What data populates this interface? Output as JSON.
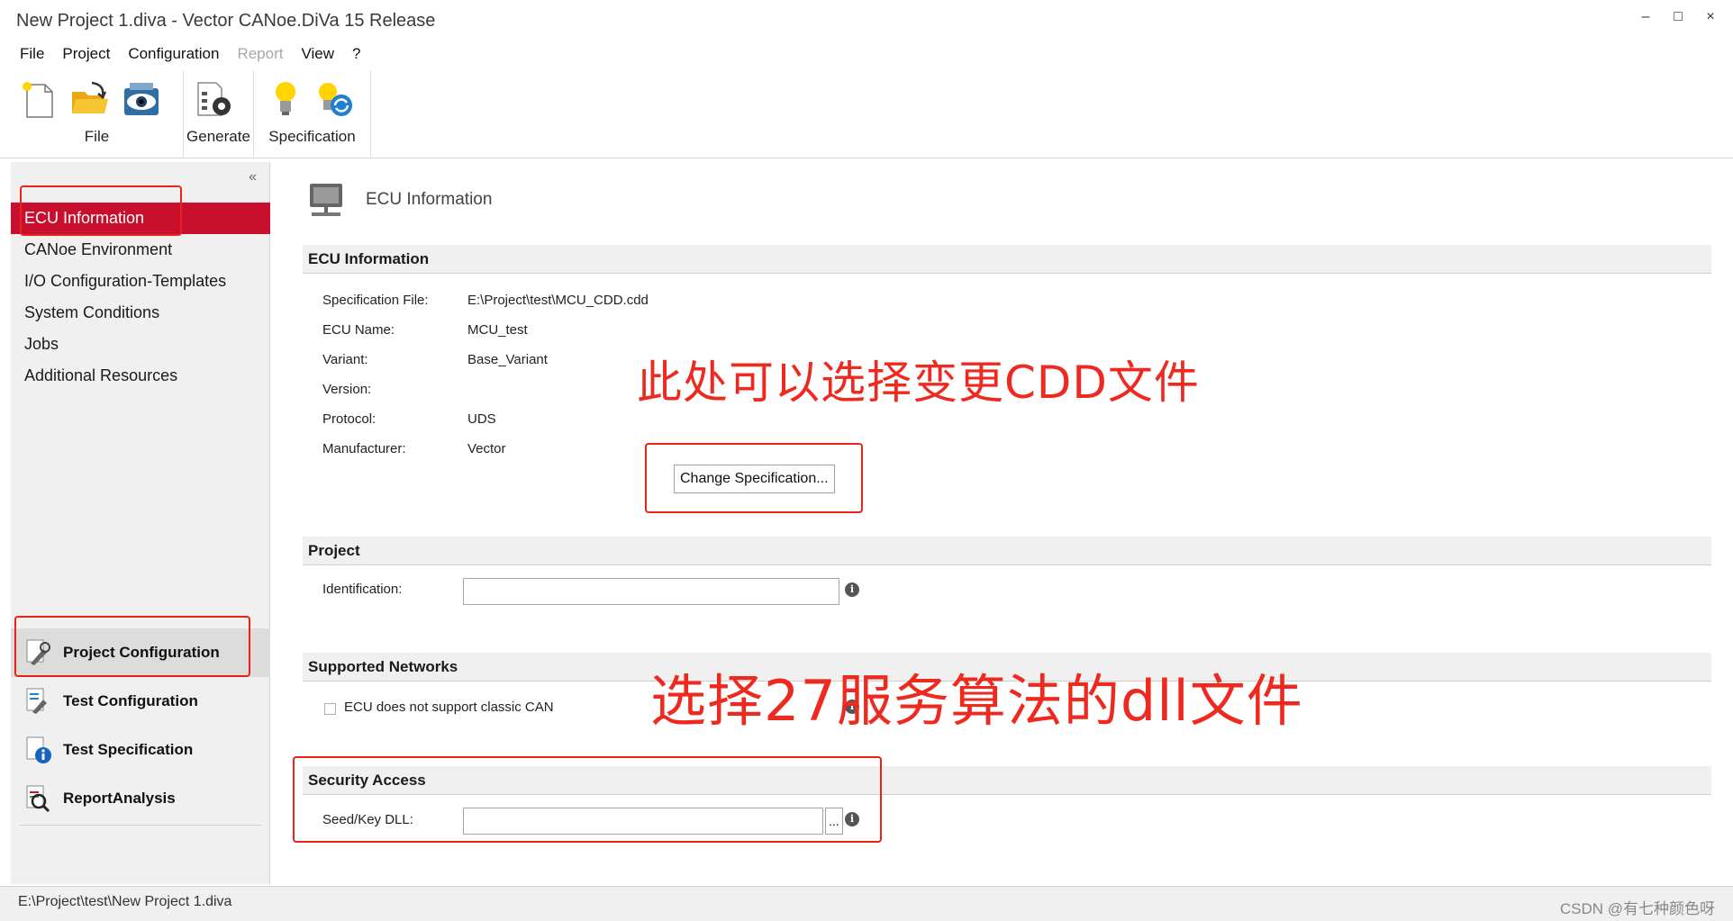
{
  "window": {
    "title": "New Project 1.diva - Vector CANoe.DiVa 15 Release",
    "minimize": "–",
    "maximize": "□",
    "close": "×"
  },
  "menu": {
    "file": "File",
    "project": "Project",
    "configuration": "Configuration",
    "report": "Report",
    "view": "View",
    "help": "?"
  },
  "ribbon": {
    "file_group": "File",
    "generate_group": "Generate",
    "specification_group": "Specification"
  },
  "sidebar": {
    "collapse": "«",
    "items": [
      {
        "label": "ECU Information"
      },
      {
        "label": "CANoe Environment"
      },
      {
        "label": "I/O Configuration-Templates"
      },
      {
        "label": "System Conditions"
      },
      {
        "label": "Jobs"
      },
      {
        "label": "Additional Resources"
      }
    ],
    "bottom": [
      {
        "label": "Project Configuration"
      },
      {
        "label": "Test Configuration"
      },
      {
        "label": "Test Specification"
      },
      {
        "label": "ReportAnalysis"
      }
    ]
  },
  "main": {
    "page_title": "ECU Information",
    "ecu_section": "ECU Information",
    "fields": [
      {
        "label": "Specification File:",
        "value": "E:\\Project\\test\\MCU_CDD.cdd"
      },
      {
        "label": "ECU Name:",
        "value": "MCU_test"
      },
      {
        "label": "Variant:",
        "value": "Base_Variant"
      },
      {
        "label": "Version:",
        "value": ""
      },
      {
        "label": "Protocol:",
        "value": "UDS"
      },
      {
        "label": "Manufacturer:",
        "value": "Vector"
      }
    ],
    "change_spec_button": "Change Specification...",
    "project_section": "Project",
    "identification_label": "Identification:",
    "identification_value": "",
    "networks_section": "Supported Networks",
    "no_classic_can_label": "ECU does not support classic CAN",
    "security_section": "Security Access",
    "seed_key_label": "Seed/Key DLL:",
    "seed_key_value": "",
    "browse_button": "...",
    "info_glyph": "i"
  },
  "annotations": {
    "cdd_note": "此处可以选择变更CDD文件",
    "dll_note": "选择27服务算法的dll文件"
  },
  "status": {
    "path": "E:\\Project\\test\\New Project 1.diva",
    "watermark": "CSDN @有七种颜色呀"
  },
  "colors": {
    "accent_red": "#c8102e",
    "annotation_red": "#ee2a20"
  }
}
